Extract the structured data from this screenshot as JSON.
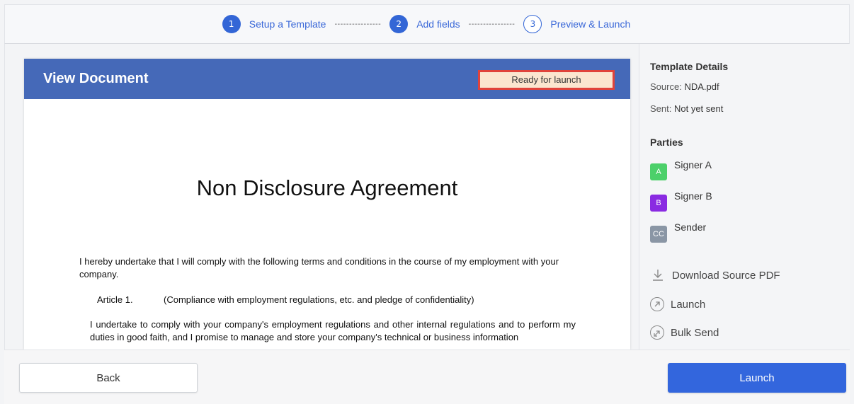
{
  "stepper": {
    "steps": [
      {
        "number": "1",
        "label": "Setup a Template",
        "state": "done"
      },
      {
        "number": "2",
        "label": "Add fields",
        "state": "done"
      },
      {
        "number": "3",
        "label": "Preview & Launch",
        "state": "current"
      }
    ],
    "separator": "----------------"
  },
  "document": {
    "header_title": "View Document",
    "status": "Ready for launch",
    "heading": "Non Disclosure Agreement",
    "paragraph1": "I hereby undertake that I will comply with the following terms and conditions in the course of my employment with your company.",
    "article_number": "Article 1.",
    "article_title": "(Compliance with employment regulations, etc. and pledge of confidentiality)",
    "paragraph2": "I undertake to comply with your company's employment regulations and other internal regulations and to perform my duties in good faith, and I promise to manage and store your company's technical or business information"
  },
  "sidebar": {
    "details_title": "Template Details",
    "source_label": "Source:",
    "source_value": "NDA.pdf",
    "sent_label": "Sent:",
    "sent_value": "Not yet sent",
    "parties_title": "Parties",
    "parties": [
      {
        "initial": "A",
        "name": "Signer A",
        "color": "#4cd06a"
      },
      {
        "initial": "B",
        "name": "Signer B",
        "color": "#8a2be2"
      },
      {
        "initial": "CC",
        "name": "Sender",
        "color": "#8a96a5"
      }
    ],
    "actions": {
      "download": "Download Source PDF",
      "launch": "Launch",
      "bulk_send": "Bulk Send"
    }
  },
  "footer": {
    "back_label": "Back",
    "launch_label": "Launch"
  },
  "colors": {
    "primary": "#3366dd",
    "header_bar": "#4569b8",
    "badge_border": "#e0433b",
    "badge_fill": "#fbe6cf"
  }
}
